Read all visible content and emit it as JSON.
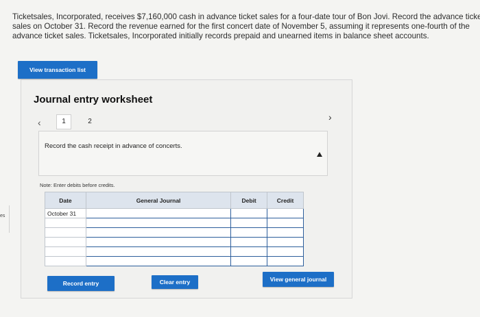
{
  "problem": {
    "line1": "Ticketsales, Incorporated, receives $7,160,000 cash in advance ticket sales for a four-date tour of Bon Jovi. Record the advance ticke",
    "line2": "sales on October 31. Record the revenue earned for the first concert date of November 5, assuming it represents one-fourth of the",
    "line3": "advance ticket sales. Ticketsales, Incorporated initially records prepaid and unearned items in balance sheet accounts."
  },
  "side_tab": "es",
  "buttons": {
    "view_transactions": "View transaction list",
    "record_entry": "Record entry",
    "clear_entry": "Clear entry",
    "view_journal": "View general journal"
  },
  "worksheet": {
    "title": "Journal entry worksheet",
    "tabs": [
      "1",
      "2"
    ],
    "prev_icon": "‹",
    "next_icon": "›",
    "instruction": "Record the cash receipt in advance of concerts.",
    "note": "Note: Enter debits before credits."
  },
  "journal": {
    "headers": {
      "date": "Date",
      "account": "General Journal",
      "debit": "Debit",
      "credit": "Credit"
    },
    "rows": [
      {
        "date": "October 31",
        "account": "",
        "debit": "",
        "credit": ""
      },
      {
        "date": "",
        "account": "",
        "debit": "",
        "credit": ""
      },
      {
        "date": "",
        "account": "",
        "debit": "",
        "credit": ""
      },
      {
        "date": "",
        "account": "",
        "debit": "",
        "credit": ""
      },
      {
        "date": "",
        "account": "",
        "debit": "",
        "credit": ""
      },
      {
        "date": "",
        "account": "",
        "debit": "",
        "credit": ""
      }
    ]
  },
  "colors": {
    "button": "#1d6fc7",
    "header": "#dde4ed",
    "entry_border": "#2b5d9b"
  }
}
